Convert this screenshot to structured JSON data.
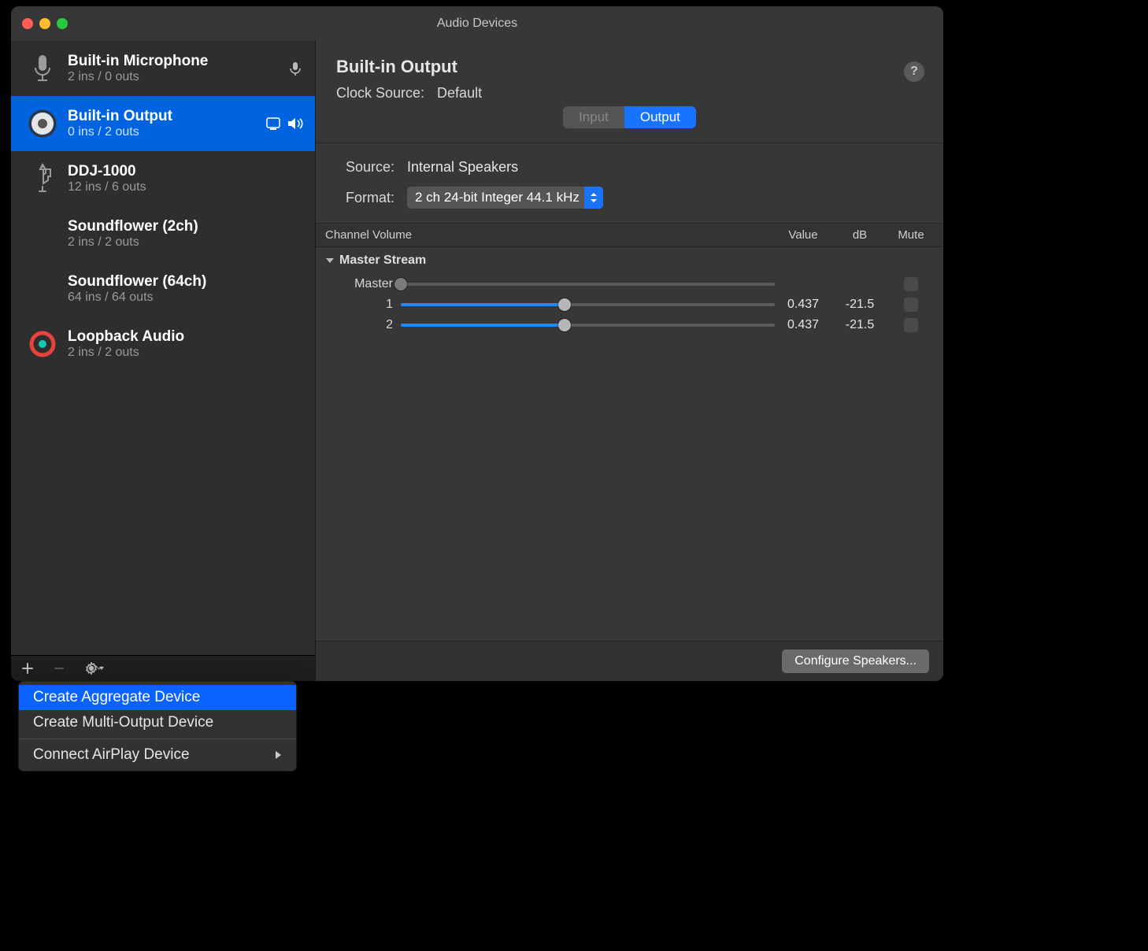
{
  "window_title": "Audio Devices",
  "sidebar": {
    "devices": [
      {
        "name": "Built-in Microphone",
        "io": "2 ins / 0 outs",
        "icon": "mic",
        "selected": false,
        "input_badge": true
      },
      {
        "name": "Built-in Output",
        "io": "0 ins / 2 outs",
        "icon": "speaker",
        "selected": true,
        "system_badge": true,
        "output_badge": true
      },
      {
        "name": "DDJ-1000",
        "io": "12 ins / 6 outs",
        "icon": "usb",
        "selected": false
      },
      {
        "name": "Soundflower (2ch)",
        "io": "2 ins / 2 outs",
        "icon": "none",
        "selected": false
      },
      {
        "name": "Soundflower (64ch)",
        "io": "64 ins / 64 outs",
        "icon": "none",
        "selected": false
      },
      {
        "name": "Loopback Audio",
        "io": "2 ins / 2 outs",
        "icon": "loopback",
        "selected": false
      }
    ],
    "toolbar": {
      "add": "+",
      "remove": "−",
      "gear": "gear"
    }
  },
  "main": {
    "title": "Built-in Output",
    "clock_label": "Clock Source:",
    "clock_value": "Default",
    "tabs": {
      "input": "Input",
      "output": "Output",
      "active": "Output"
    },
    "source_label": "Source:",
    "source_value": "Internal Speakers",
    "format_label": "Format:",
    "format_value": "2 ch 24-bit Integer 44.1 kHz",
    "vol_header": {
      "channel": "Channel Volume",
      "value": "Value",
      "db": "dB",
      "mute": "Mute"
    },
    "stream": "Master Stream",
    "rows": [
      {
        "name": "Master",
        "pos": 0,
        "value": "",
        "db": "",
        "fill": false,
        "mute": true,
        "disabled": true
      },
      {
        "name": "1",
        "pos": 0.437,
        "value": "0.437",
        "db": "-21.5",
        "fill": true,
        "mute": true
      },
      {
        "name": "2",
        "pos": 0.437,
        "value": "0.437",
        "db": "-21.5",
        "fill": true,
        "mute": true
      }
    ],
    "configure": "Configure Speakers..."
  },
  "popup": {
    "items": [
      {
        "label": "Create Aggregate Device",
        "hover": true
      },
      {
        "label": "Create Multi-Output Device"
      }
    ],
    "after_sep": {
      "label": "Connect AirPlay Device",
      "submenu": true
    }
  }
}
